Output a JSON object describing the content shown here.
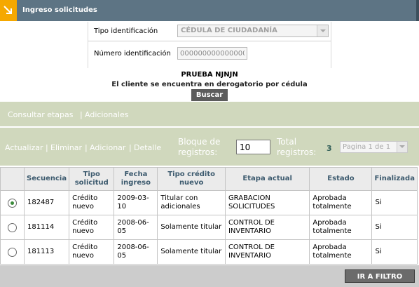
{
  "header": {
    "title": "Ingreso solicitudes",
    "icon": "arrow-corner-icon",
    "accent_color": "#f5a800",
    "bar_color": "#5d7484"
  },
  "form": {
    "tipo_label": "Tipo identificación",
    "tipo_value": "CÉDULA DE CIUDADANÍA",
    "numero_label": "Número identificación",
    "numero_value": "0000000000000001"
  },
  "client": {
    "name": "PRUEBA NJNJN",
    "message": "El cliente se encuentra en derogatorio por cédula"
  },
  "buscar_label": "Buscar",
  "links": {
    "consultar": "Consultar etapas",
    "adicionales": "Adicionales"
  },
  "actions": {
    "actualizar": "Actualizar",
    "eliminar": "Eliminar",
    "adicionar": "Adicionar",
    "detalle": "Detalle"
  },
  "pager": {
    "bloque_label_1": "Bloque de",
    "bloque_label_2": "registros:",
    "bloque_value": "10",
    "total_label_1": "Total",
    "total_label_2": "registros:",
    "total_value": "3",
    "page_value": "Pagina 1 de 1"
  },
  "table": {
    "headers": {
      "secuencia": "Secuencia",
      "tipo_solicitud": "Tipo solicitud",
      "fecha_ingreso": "Fecha ingreso",
      "tipo_credito": "Tipo crédito nuevo",
      "etapa": "Etapa actual",
      "estado": "Estado",
      "finalizada": "Finalizada"
    },
    "rows": [
      {
        "selected": true,
        "secuencia": "182487",
        "tipo_solicitud": "Crédito nuevo",
        "fecha": "2009-03-10",
        "tipo_credito": "Titular con adicionales",
        "etapa": "GRABACION SOLICITUDES",
        "estado": "Aprobada totalmente",
        "finalizada": "Si"
      },
      {
        "selected": false,
        "secuencia": "181114",
        "tipo_solicitud": "Crédito nuevo",
        "fecha": "2008-06-05",
        "tipo_credito": "Solamente titular",
        "etapa": "CONTROL DE INVENTARIO",
        "estado": "Aprobada totalmente",
        "finalizada": "Si"
      },
      {
        "selected": false,
        "secuencia": "181113",
        "tipo_solicitud": "Crédito nuevo",
        "fecha": "2008-06-05",
        "tipo_credito": "Solamente titular",
        "etapa": "CONTROL DE INVENTARIO",
        "estado": "Aprobada totalmente",
        "finalizada": "Si"
      }
    ]
  },
  "filtro_label": "IR A FILTRO"
}
